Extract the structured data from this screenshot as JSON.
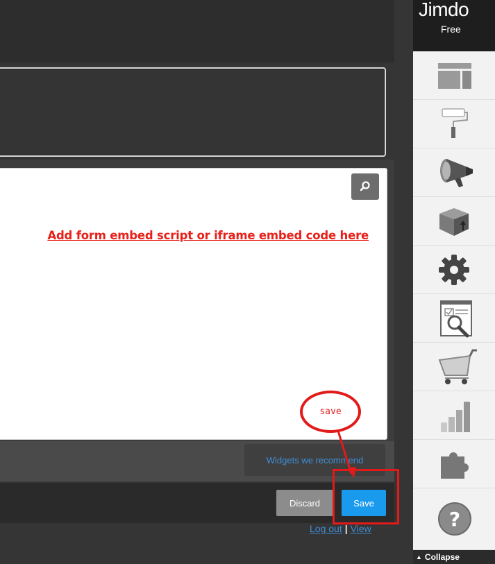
{
  "brand": {
    "name": "Jimdo",
    "plan": "Free"
  },
  "editor": {
    "annotation_text": "Add form embed script or iframe embed code here",
    "widgets_link": "Widgets we recommend",
    "discard_label": "Discard",
    "save_label": "Save",
    "save_annotation": "save"
  },
  "footer": {
    "logout_label": "Log out",
    "separator": "|",
    "view_label": "View"
  },
  "sidebar": {
    "items": [
      {
        "name": "layout-icon"
      },
      {
        "name": "paint-roller-icon"
      },
      {
        "name": "megaphone-icon"
      },
      {
        "name": "package-icon"
      },
      {
        "name": "gear-icon"
      },
      {
        "name": "seo-search-icon"
      },
      {
        "name": "shopping-cart-icon"
      },
      {
        "name": "statistics-bars-icon"
      },
      {
        "name": "puzzle-icon"
      },
      {
        "name": "help-icon"
      }
    ],
    "collapse_label": "Collapse"
  },
  "colors": {
    "annotation_red": "#e21a1a",
    "save_blue": "#1a9aed",
    "link_blue": "#3e8fd6"
  }
}
